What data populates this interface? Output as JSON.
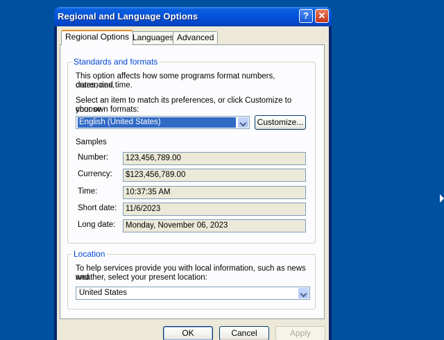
{
  "window": {
    "title": "Regional and Language Options",
    "help_label": "?",
    "close_label": "✕"
  },
  "tabs": [
    {
      "label": "Regional Options",
      "active": true
    },
    {
      "label": "Languages",
      "active": false
    },
    {
      "label": "Advanced",
      "active": false
    }
  ],
  "standards": {
    "legend": "Standards and formats",
    "description_line1": "This option affects how some programs format numbers, currencies,",
    "description_line2": "dates, and time.",
    "instruction_line1": "Select an item to match its preferences, or click Customize to choose",
    "instruction_line2": "your own formats:",
    "selected_format": "English (United States)",
    "customize_label": "Customize..."
  },
  "samples": {
    "heading": "Samples",
    "rows": [
      {
        "label": "Number:",
        "value": "123,456,789.00"
      },
      {
        "label": "Currency:",
        "value": "$123,456,789.00"
      },
      {
        "label": "Time:",
        "value": "10:37:35 AM"
      },
      {
        "label": "Short date:",
        "value": "11/6/2023"
      },
      {
        "label": "Long date:",
        "value": "Monday, November 06, 2023"
      }
    ]
  },
  "location": {
    "legend": "Location",
    "description_line1": "To help services provide you with local information, such as news and",
    "description_line2": "weather, select your present location:",
    "selected_location": "United States"
  },
  "buttons": {
    "ok": "OK",
    "cancel": "Cancel",
    "apply": "Apply"
  },
  "colors": {
    "desktop": "#0050a0",
    "titlebar": "#0452d8",
    "dialog_face": "#ece9d8",
    "legend_text": "#0046d5",
    "selection": "#316ac5"
  }
}
